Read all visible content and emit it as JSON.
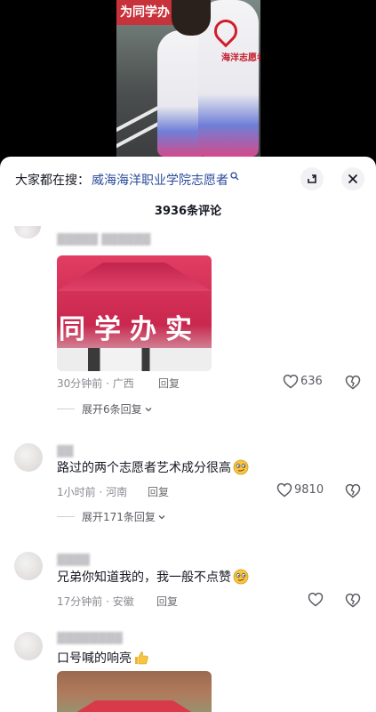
{
  "search": {
    "prefix": "大家都在搜：",
    "keyword": "威海海洋职业学院志愿者"
  },
  "comment_count_label": "3936条评论",
  "video": {
    "banner_text": "为同学办",
    "vest_text": "海洋志愿者"
  },
  "comments": [
    {
      "thumb_text": "同学办实",
      "meta": "30分钟前 · 广西",
      "reply_label": "回复",
      "likes": "636",
      "expand_label": "展开6条回复"
    },
    {
      "text": "路过的两个志愿者艺术成分很高",
      "emoji": "smirk-emoji",
      "meta": "1小时前 · 河南",
      "reply_label": "回复",
      "likes": "9810",
      "expand_label": "展开171条回复"
    },
    {
      "text": "兄弟你知道我的，我一般不点赞",
      "emoji": "smirk-emoji",
      "meta": "17分钟前 · 安徽",
      "reply_label": "回复"
    },
    {
      "text": "口号喊的响亮",
      "emoji": "thumbs-up-emoji"
    }
  ],
  "colors": {
    "keyword": "#2a4b9b",
    "sheet_bg": "#ffffff",
    "meta": "#8a8b91"
  }
}
